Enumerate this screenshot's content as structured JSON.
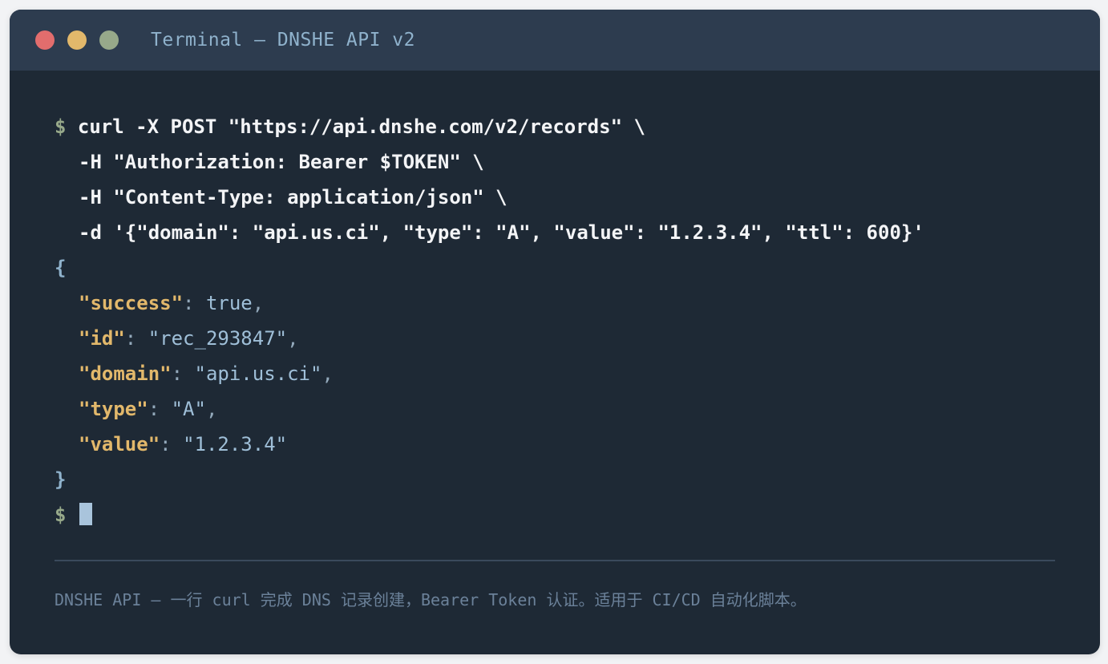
{
  "window": {
    "title": "Terminal — DNSHE API v2",
    "traffic_lights": [
      {
        "name": "close",
        "color": "#e26d6d"
      },
      {
        "name": "minimize",
        "color": "#e2b86b"
      },
      {
        "name": "maximize",
        "color": "#97a98a"
      }
    ]
  },
  "terminal": {
    "prompt": "$",
    "command": {
      "line1": "curl -X POST \"https://api.dnshe.com/v2/records\" \\",
      "line2": "-H \"Authorization: Bearer $TOKEN\" \\",
      "line3": "-H \"Content-Type: application/json\" \\",
      "line4": "-d '{\"domain\": \"api.us.ci\", \"type\": \"A\", \"value\": \"1.2.3.4\", \"ttl\": 600}'"
    },
    "response": {
      "open_brace": "{",
      "close_brace": "}",
      "fields": [
        {
          "key": "\"success\"",
          "sep": ": ",
          "value": "true",
          "trail": ","
        },
        {
          "key": "\"id\"",
          "sep": ": ",
          "value": "\"rec_293847\"",
          "trail": ","
        },
        {
          "key": "\"domain\"",
          "sep": ": ",
          "value": "\"api.us.ci\"",
          "trail": ","
        },
        {
          "key": "\"type\"",
          "sep": ": ",
          "value": "\"A\"",
          "trail": ","
        },
        {
          "key": "\"value\"",
          "sep": ": ",
          "value": "\"1.2.3.4\"",
          "trail": ""
        }
      ]
    }
  },
  "footer": {
    "text": "DNSHE API — 一行 curl 完成 DNS 记录创建，Bearer Token 认证。适用于 CI/CD 自动化脚本。"
  },
  "colors": {
    "background": "#1e2935",
    "titlebar": "#2d3c4f",
    "prompt": "#97a98a",
    "json_key": "#e2b86b",
    "json_value": "#9fbfd8"
  }
}
